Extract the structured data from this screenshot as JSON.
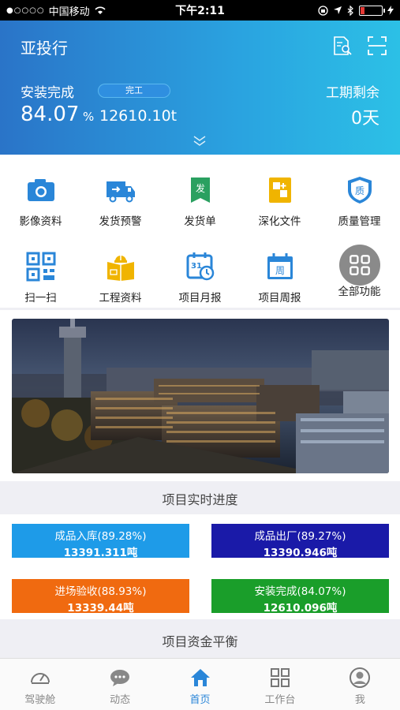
{
  "status_bar": {
    "carrier": "中国移动",
    "signal_dots": "●○○○○",
    "time": "下午2:11"
  },
  "header": {
    "title": "亚投行",
    "install_label": "安装完成",
    "badge": "完工",
    "percent": "84.07",
    "percent_unit": "%",
    "tonnage": "12610.10t",
    "remaining_label": "工期剩余",
    "remaining_value": "0天"
  },
  "functions": [
    {
      "label": "影像资料",
      "icon": "camera-icon",
      "color": "#2a86d8"
    },
    {
      "label": "发货预警",
      "icon": "truck-icon",
      "color": "#2a86d8"
    },
    {
      "label": "发货单",
      "icon": "invoice-icon",
      "color": "#2aa060"
    },
    {
      "label": "深化文件",
      "icon": "deepen-file-icon",
      "color": "#f0b400"
    },
    {
      "label": "质量管理",
      "icon": "quality-shield-icon",
      "color": "#2a86d8"
    },
    {
      "label": "扫一扫",
      "icon": "qr-code-icon",
      "color": "#2a86d8"
    },
    {
      "label": "工程资料",
      "icon": "engineering-book-icon",
      "color": "#f0b400"
    },
    {
      "label": "项目月报",
      "icon": "monthly-calendar-icon",
      "color": "#2a86d8"
    },
    {
      "label": "项目周报",
      "icon": "weekly-calendar-icon",
      "color": "#2a86d8"
    },
    {
      "label": "全部功能",
      "icon": "all-functions-icon",
      "color": "#888888"
    }
  ],
  "progress": {
    "title": "项目实时进度",
    "items": [
      {
        "title": "成品入库(89.28%)",
        "value": "13391.311吨",
        "color": "#1e9be8"
      },
      {
        "title": "成品出厂(89.27%)",
        "value": "13390.946吨",
        "color": "#1a1aa8"
      },
      {
        "title": "进场验收(88.93%)",
        "value": "13339.44吨",
        "color": "#f06a10"
      },
      {
        "title": "安装完成(84.07%)",
        "value": "12610.096吨",
        "color": "#1a9e2a"
      }
    ]
  },
  "funds_title": "项目资金平衡",
  "tabs": [
    {
      "label": "驾驶舱",
      "icon": "dashboard-gauge-icon"
    },
    {
      "label": "动态",
      "icon": "chat-bubble-icon"
    },
    {
      "label": "首页",
      "icon": "home-icon",
      "active": true
    },
    {
      "label": "工作台",
      "icon": "workbench-grid-icon"
    },
    {
      "label": "我",
      "icon": "user-icon"
    }
  ]
}
